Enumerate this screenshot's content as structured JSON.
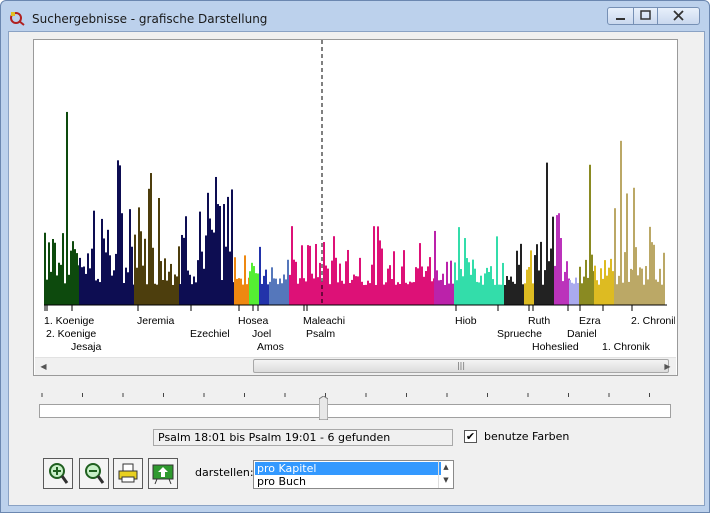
{
  "window": {
    "title": "Suchergebnisse - grafische Darstellung"
  },
  "chart_data": {
    "type": "bar",
    "book_labels_row1": [
      "1. Koenige",
      "Jeremia",
      "Hosea",
      "Maleachi",
      "Hiob",
      "Ruth",
      "Ezra",
      "2. Chronik"
    ],
    "book_labels_row2": [
      "2. Koenige",
      "Ezechiel",
      "Joel",
      "Psalm",
      "Sprueche",
      "Daniel"
    ],
    "book_labels_row3": [
      "Jesaja",
      "Amos",
      "Hoheslied",
      "1. Chronik"
    ],
    "colors": [
      "#0d4a0d",
      "#0d0d52",
      "#4d3e0d",
      "#ee8811",
      "#55ee33",
      "#2233aa",
      "#5577bb",
      "#dd1177",
      "#bb22aa",
      "#33ddaa",
      "#222222",
      "#ddbb22",
      "#bb33bb",
      "#aaaaee",
      "#8a8a22",
      "#bba866"
    ]
  },
  "status": {
    "text": "Psalm 18:01 bis Psalm 19:01 - 6 gefunden"
  },
  "options": {
    "use_colors_label": "benutze Farben",
    "use_colors_checked": "✔"
  },
  "display": {
    "label": "darstellen:",
    "options": [
      "pro Kapitel",
      "pro Buch"
    ]
  }
}
